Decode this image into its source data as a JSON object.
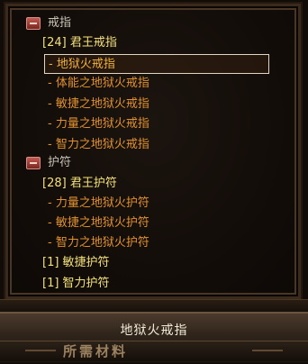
{
  "categories": [
    {
      "label": "戒指",
      "items": [
        {
          "text": "[24]  君王戒指"
        },
        {
          "text": "-  地狱火戒指"
        },
        {
          "text": "-  体能之地狱火戒指"
        },
        {
          "text": "-  敏捷之地狱火戒指"
        },
        {
          "text": "-  力量之地狱火戒指"
        },
        {
          "text": "-  智力之地狱火戒指"
        }
      ]
    },
    {
      "label": "护符",
      "items": [
        {
          "text": "[28]  君王护符"
        },
        {
          "text": "-  力量之地狱火护符"
        },
        {
          "text": "-  敏捷之地狱火护符"
        },
        {
          "text": "-  智力之地狱火护符"
        },
        {
          "text": "[1]  敏捷护符"
        },
        {
          "text": "[1]  智力护符"
        }
      ]
    }
  ],
  "detail": {
    "title": "地狱火戒指",
    "subtitle": "所需材料"
  },
  "colors": {
    "set_yellow": "#f3e07a",
    "legendary_orange": "#e0902e",
    "category_gray": "#c8c2b6"
  },
  "icons": {
    "category": "collapse-minus-icon"
  }
}
